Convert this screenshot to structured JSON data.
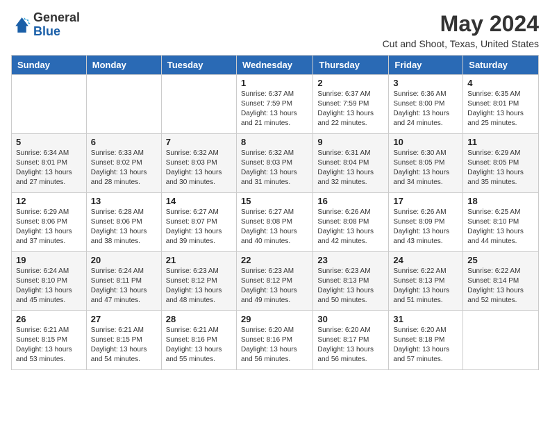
{
  "header": {
    "logo": {
      "line1": "General",
      "line2": "Blue"
    },
    "title": "May 2024",
    "location": "Cut and Shoot, Texas, United States"
  },
  "weekdays": [
    "Sunday",
    "Monday",
    "Tuesday",
    "Wednesday",
    "Thursday",
    "Friday",
    "Saturday"
  ],
  "weeks": [
    [
      {
        "day": "",
        "info": ""
      },
      {
        "day": "",
        "info": ""
      },
      {
        "day": "",
        "info": ""
      },
      {
        "day": "1",
        "info": "Sunrise: 6:37 AM\nSunset: 7:59 PM\nDaylight: 13 hours\nand 21 minutes."
      },
      {
        "day": "2",
        "info": "Sunrise: 6:37 AM\nSunset: 7:59 PM\nDaylight: 13 hours\nand 22 minutes."
      },
      {
        "day": "3",
        "info": "Sunrise: 6:36 AM\nSunset: 8:00 PM\nDaylight: 13 hours\nand 24 minutes."
      },
      {
        "day": "4",
        "info": "Sunrise: 6:35 AM\nSunset: 8:01 PM\nDaylight: 13 hours\nand 25 minutes."
      }
    ],
    [
      {
        "day": "5",
        "info": "Sunrise: 6:34 AM\nSunset: 8:01 PM\nDaylight: 13 hours\nand 27 minutes."
      },
      {
        "day": "6",
        "info": "Sunrise: 6:33 AM\nSunset: 8:02 PM\nDaylight: 13 hours\nand 28 minutes."
      },
      {
        "day": "7",
        "info": "Sunrise: 6:32 AM\nSunset: 8:03 PM\nDaylight: 13 hours\nand 30 minutes."
      },
      {
        "day": "8",
        "info": "Sunrise: 6:32 AM\nSunset: 8:03 PM\nDaylight: 13 hours\nand 31 minutes."
      },
      {
        "day": "9",
        "info": "Sunrise: 6:31 AM\nSunset: 8:04 PM\nDaylight: 13 hours\nand 32 minutes."
      },
      {
        "day": "10",
        "info": "Sunrise: 6:30 AM\nSunset: 8:05 PM\nDaylight: 13 hours\nand 34 minutes."
      },
      {
        "day": "11",
        "info": "Sunrise: 6:29 AM\nSunset: 8:05 PM\nDaylight: 13 hours\nand 35 minutes."
      }
    ],
    [
      {
        "day": "12",
        "info": "Sunrise: 6:29 AM\nSunset: 8:06 PM\nDaylight: 13 hours\nand 37 minutes."
      },
      {
        "day": "13",
        "info": "Sunrise: 6:28 AM\nSunset: 8:06 PM\nDaylight: 13 hours\nand 38 minutes."
      },
      {
        "day": "14",
        "info": "Sunrise: 6:27 AM\nSunset: 8:07 PM\nDaylight: 13 hours\nand 39 minutes."
      },
      {
        "day": "15",
        "info": "Sunrise: 6:27 AM\nSunset: 8:08 PM\nDaylight: 13 hours\nand 40 minutes."
      },
      {
        "day": "16",
        "info": "Sunrise: 6:26 AM\nSunset: 8:08 PM\nDaylight: 13 hours\nand 42 minutes."
      },
      {
        "day": "17",
        "info": "Sunrise: 6:26 AM\nSunset: 8:09 PM\nDaylight: 13 hours\nand 43 minutes."
      },
      {
        "day": "18",
        "info": "Sunrise: 6:25 AM\nSunset: 8:10 PM\nDaylight: 13 hours\nand 44 minutes."
      }
    ],
    [
      {
        "day": "19",
        "info": "Sunrise: 6:24 AM\nSunset: 8:10 PM\nDaylight: 13 hours\nand 45 minutes."
      },
      {
        "day": "20",
        "info": "Sunrise: 6:24 AM\nSunset: 8:11 PM\nDaylight: 13 hours\nand 47 minutes."
      },
      {
        "day": "21",
        "info": "Sunrise: 6:23 AM\nSunset: 8:12 PM\nDaylight: 13 hours\nand 48 minutes."
      },
      {
        "day": "22",
        "info": "Sunrise: 6:23 AM\nSunset: 8:12 PM\nDaylight: 13 hours\nand 49 minutes."
      },
      {
        "day": "23",
        "info": "Sunrise: 6:23 AM\nSunset: 8:13 PM\nDaylight: 13 hours\nand 50 minutes."
      },
      {
        "day": "24",
        "info": "Sunrise: 6:22 AM\nSunset: 8:13 PM\nDaylight: 13 hours\nand 51 minutes."
      },
      {
        "day": "25",
        "info": "Sunrise: 6:22 AM\nSunset: 8:14 PM\nDaylight: 13 hours\nand 52 minutes."
      }
    ],
    [
      {
        "day": "26",
        "info": "Sunrise: 6:21 AM\nSunset: 8:15 PM\nDaylight: 13 hours\nand 53 minutes."
      },
      {
        "day": "27",
        "info": "Sunrise: 6:21 AM\nSunset: 8:15 PM\nDaylight: 13 hours\nand 54 minutes."
      },
      {
        "day": "28",
        "info": "Sunrise: 6:21 AM\nSunset: 8:16 PM\nDaylight: 13 hours\nand 55 minutes."
      },
      {
        "day": "29",
        "info": "Sunrise: 6:20 AM\nSunset: 8:16 PM\nDaylight: 13 hours\nand 56 minutes."
      },
      {
        "day": "30",
        "info": "Sunrise: 6:20 AM\nSunset: 8:17 PM\nDaylight: 13 hours\nand 56 minutes."
      },
      {
        "day": "31",
        "info": "Sunrise: 6:20 AM\nSunset: 8:18 PM\nDaylight: 13 hours\nand 57 minutes."
      },
      {
        "day": "",
        "info": ""
      }
    ]
  ]
}
